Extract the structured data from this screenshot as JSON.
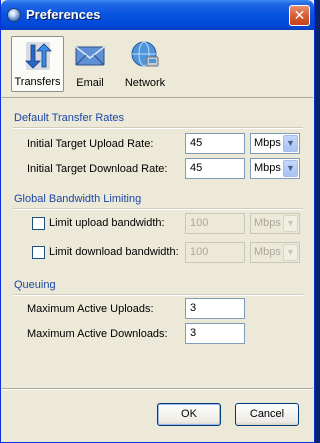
{
  "window": {
    "title": "Preferences",
    "close_glyph": "✕"
  },
  "toolbar": {
    "items": [
      {
        "label": "Transfers",
        "icon": "transfer-arrows-icon",
        "selected": true
      },
      {
        "label": "Email",
        "icon": "envelope-icon",
        "selected": false
      },
      {
        "label": "Network",
        "icon": "network-globe-icon",
        "selected": false
      }
    ]
  },
  "rates": {
    "title": "Default Transfer Rates",
    "upload_label": "Initial Target Upload Rate:",
    "upload_value": "45",
    "upload_unit": "Mbps",
    "download_label": "Initial Target Download Rate:",
    "download_value": "45",
    "download_unit": "Mbps"
  },
  "bandwidth": {
    "title": "Global Bandwidth Limiting",
    "upload_label": "Limit upload bandwidth:",
    "upload_checked": false,
    "upload_value": "100",
    "upload_unit": "Mbps",
    "download_label": "Limit download bandwidth:",
    "download_checked": false,
    "download_value": "100",
    "download_unit": "Mbps"
  },
  "queuing": {
    "title": "Queuing",
    "uploads_label": "Maximum Active Uploads:",
    "uploads_value": "3",
    "downloads_label": "Maximum Active Downloads:",
    "downloads_value": "3"
  },
  "buttons": {
    "ok": "OK",
    "cancel": "Cancel"
  },
  "colors": {
    "section_title": "#1c47a7",
    "titlebar": "#0a55e0",
    "close": "#d65a2f"
  }
}
